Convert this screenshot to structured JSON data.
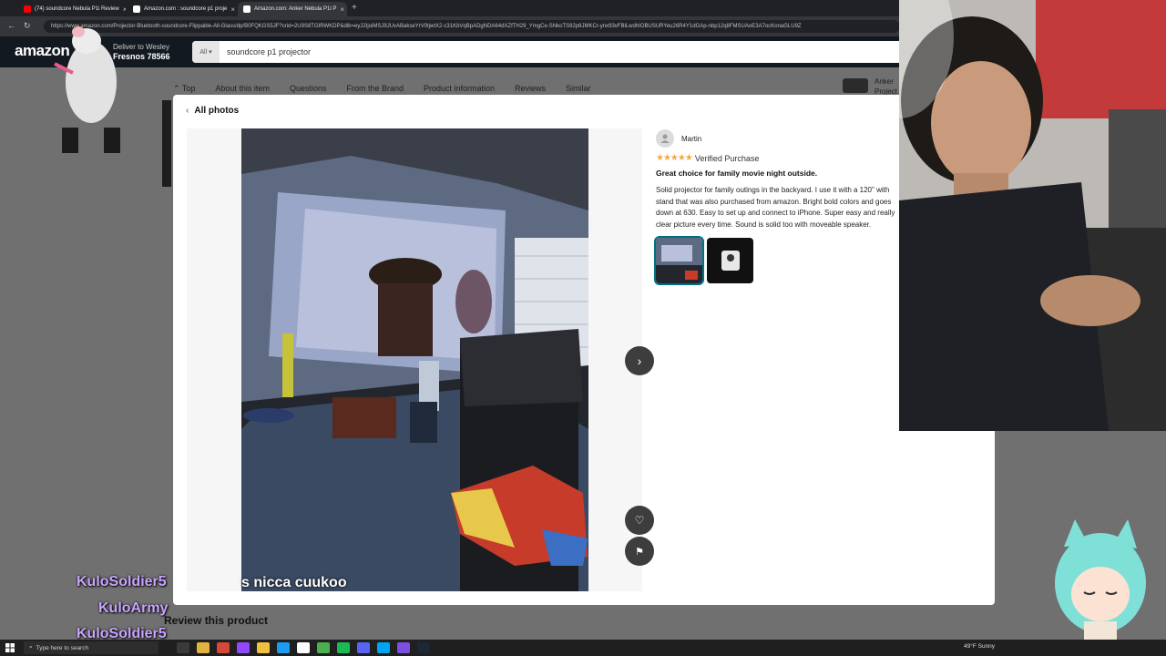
{
  "browser": {
    "tabs": [
      {
        "label": "(74) soundcore Nebula P1i Review",
        "color": "#ff0000"
      },
      {
        "label": "Amazon.com : soundcore p1 proje",
        "color": "#ffffff"
      },
      {
        "label": "Amazon.com: Anker Nebula P1i P",
        "color": "#ffffff"
      }
    ],
    "url": "https://www.amazon.com/Projector-Bluetooth-soundcore-Flippable-All-Glass/dp/B0FQKGS5JF?crid=2U9S8TGIRWKDP&dib=eyJ2IjoiMSJ9JUvABakseYrV0tjwtX2-c31KbVqBpADgNDA64dXZfTH29_YmgCe-SNkoTS92p6JMKCr-ynx93vFBlLwdhIOBUSURYeu26R4Y1dGAp-nbp12q8FMSUAoE3A7ocKonaGLU9Z"
  },
  "amazon": {
    "logo": "amazon",
    "deliver_line1": "Deliver to Wesley",
    "deliver_line2": "Fresnos 78566",
    "search_category": "All",
    "search_value": "soundcore p1 projector"
  },
  "subnav": [
    "Top",
    "About this item",
    "Questions",
    "From the Brand",
    "Product information",
    "Reviews",
    "Similar"
  ],
  "anker": {
    "line1": "Anker",
    "line2": "Project"
  },
  "modal": {
    "back_label": "All photos",
    "reviewer": "Martin",
    "verified": "Verified Purchase",
    "stars": "★★★★★",
    "title": "Great choice for family movie night outside.",
    "body": "Solid projector for family outings in the backyard. I use it with a 120\" with stand that was also purchased from amazon. Bright bold colors and goes down at 630. Easy to set up and connect to iPhone. Super easy and really clear picture every time. Sound is solid too with moveable speaker."
  },
  "chat": [
    {
      "user": "KuloSoldier5",
      "msg": "cardi this nicca cuukoo"
    },
    {
      "user": "KuloArmy",
      "msg": ""
    },
    {
      "user": "KuloSoldier5",
      "msg": ""
    }
  ],
  "caption": "s nicca cuukoo",
  "review_this": "Review this product",
  "taskbar": {
    "search_placeholder": "Type here to search",
    "weather": "49°F  Sunny"
  },
  "colors": {
    "accent": "#f3a847",
    "amazon_dark": "#131921",
    "selected_thumb": "#007185"
  }
}
